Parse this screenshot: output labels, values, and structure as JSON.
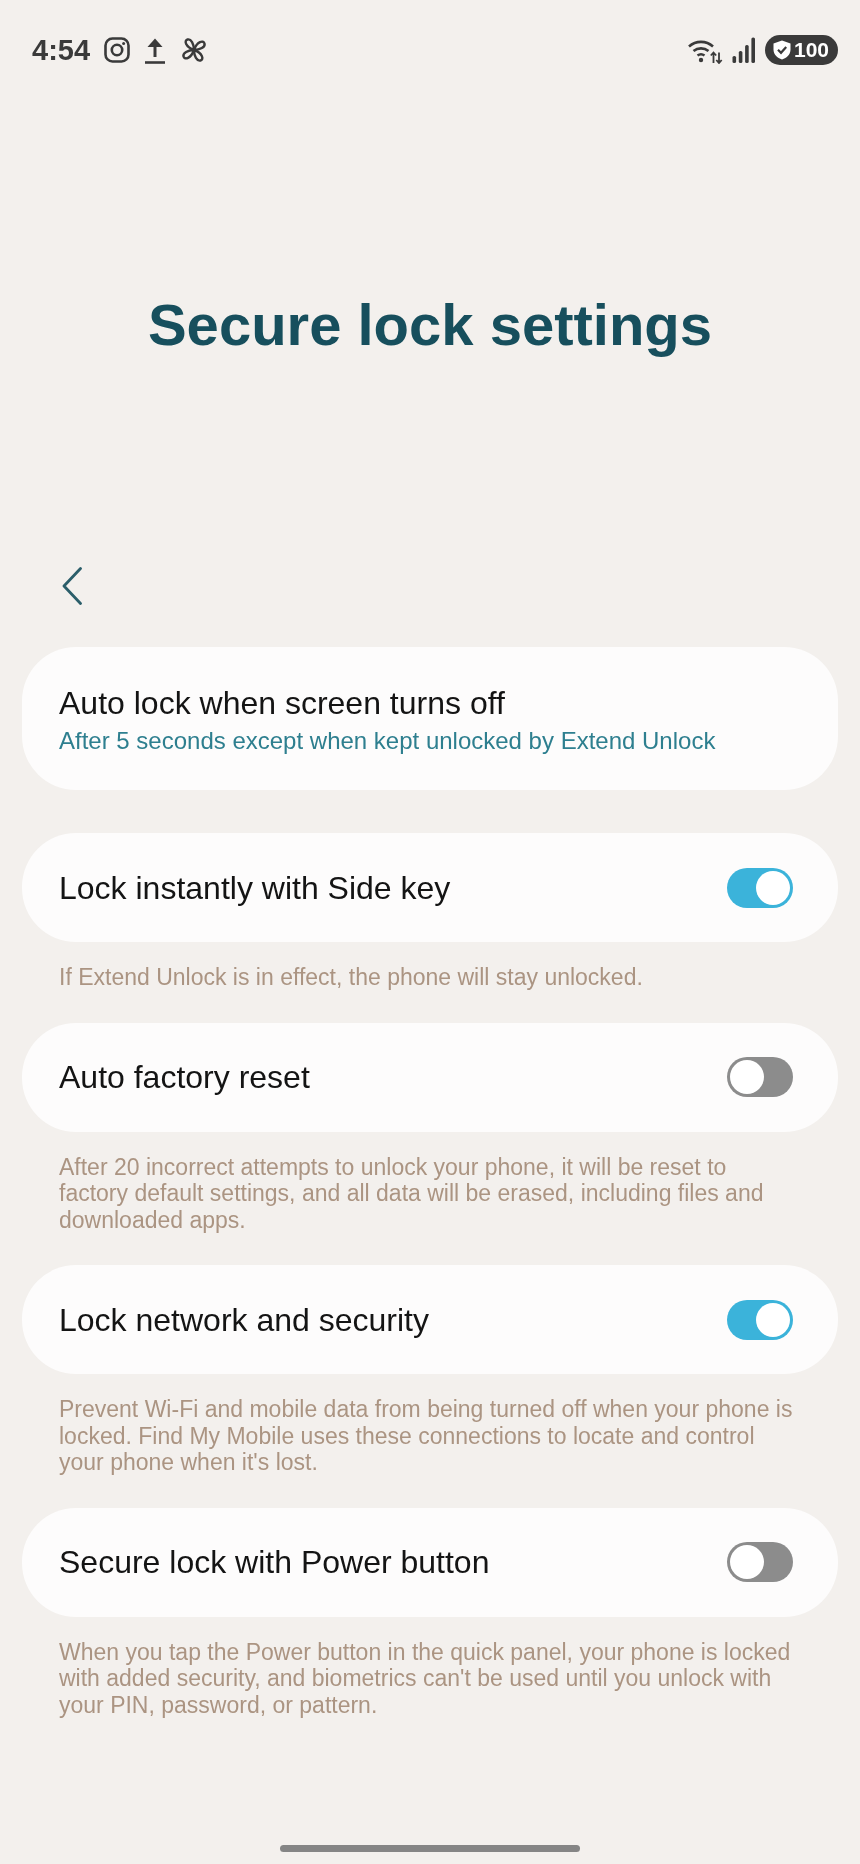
{
  "status_bar": {
    "time": "4:54",
    "battery": "100"
  },
  "header": {
    "title": "Secure lock settings"
  },
  "settings": [
    {
      "kind": "link",
      "title": "Auto lock when screen turns off",
      "subtitle": "After 5 seconds except when kept unlocked by Extend Unlock"
    },
    {
      "kind": "toggle",
      "title": "Lock instantly with Side key",
      "on": true,
      "description": "If Extend Unlock is in effect, the phone will stay unlocked."
    },
    {
      "kind": "toggle",
      "title": "Auto factory reset",
      "on": false,
      "description": "After 20 incorrect attempts to unlock your phone, it will be reset to factory default settings, and all data will be erased, including files and downloaded apps."
    },
    {
      "kind": "toggle",
      "title": "Lock network and security",
      "on": true,
      "description": "Prevent Wi-Fi and mobile data from being turned off when your phone is locked. Find My Mobile uses these connections to locate and control your phone when it's lost."
    },
    {
      "kind": "toggle",
      "title": "Secure lock with Power button",
      "on": false,
      "description": "When you tap the Power button in the quick panel, your phone is locked with added security, and biometrics can't be used until you unlock with your PIN, password, or pattern."
    }
  ]
}
